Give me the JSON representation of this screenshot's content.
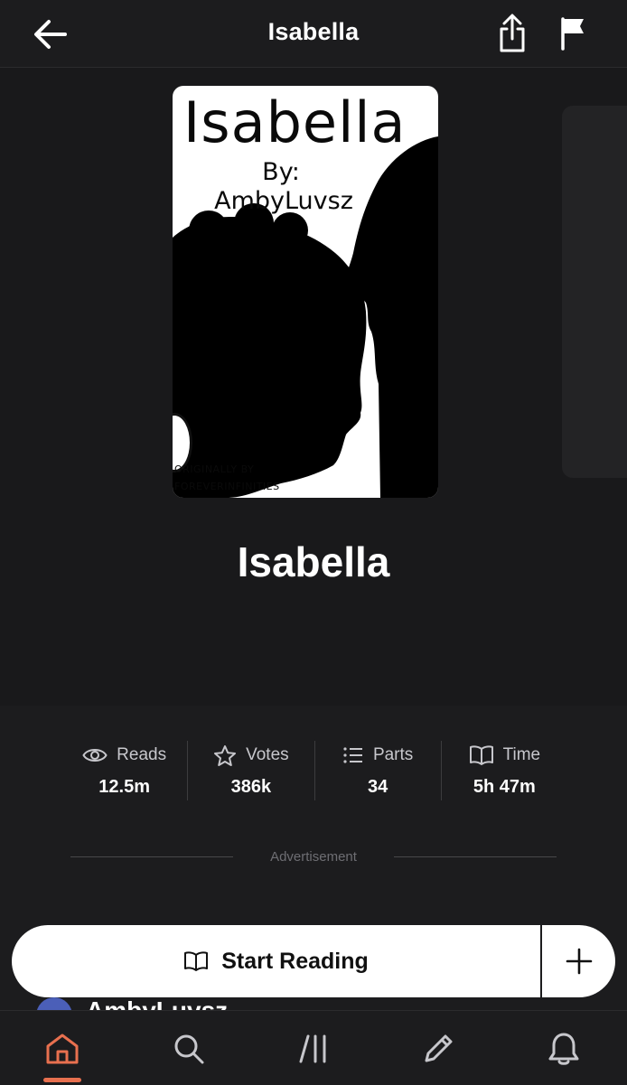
{
  "header": {
    "title": "Isabella",
    "back_icon": "arrow-left-icon",
    "share_icon": "share-icon",
    "report_icon": "flag-icon"
  },
  "cover": {
    "title": "Isabella",
    "by": "By:",
    "author": "AmbyLuvsz",
    "credit_line1": "ORIGINALLY BY",
    "credit_line2": "FOREVERINFINITIES"
  },
  "story": {
    "title": "Isabella"
  },
  "stats": [
    {
      "icon": "eye-icon",
      "label": "Reads",
      "value": "12.5m"
    },
    {
      "icon": "star-icon",
      "label": "Votes",
      "value": "386k"
    },
    {
      "icon": "list-icon",
      "label": "Parts",
      "value": "34"
    },
    {
      "icon": "book-icon",
      "label": "Time",
      "value": "5h 47m"
    }
  ],
  "advertisement": {
    "label": "Advertisement"
  },
  "author_peek": {
    "name": "AmbyLuvsz"
  },
  "actions": {
    "start_reading": "Start Reading",
    "add_icon": "plus-icon"
  },
  "bottom_nav": [
    {
      "icon": "home-icon",
      "active": true
    },
    {
      "icon": "search-icon",
      "active": false
    },
    {
      "icon": "library-icon",
      "active": false
    },
    {
      "icon": "pencil-icon",
      "active": false
    },
    {
      "icon": "bell-icon",
      "active": false
    }
  ],
  "colors": {
    "background": "#1c1c1e",
    "accent": "#e8704f",
    "text": "#ffffff",
    "muted": "#c7c7cc"
  }
}
